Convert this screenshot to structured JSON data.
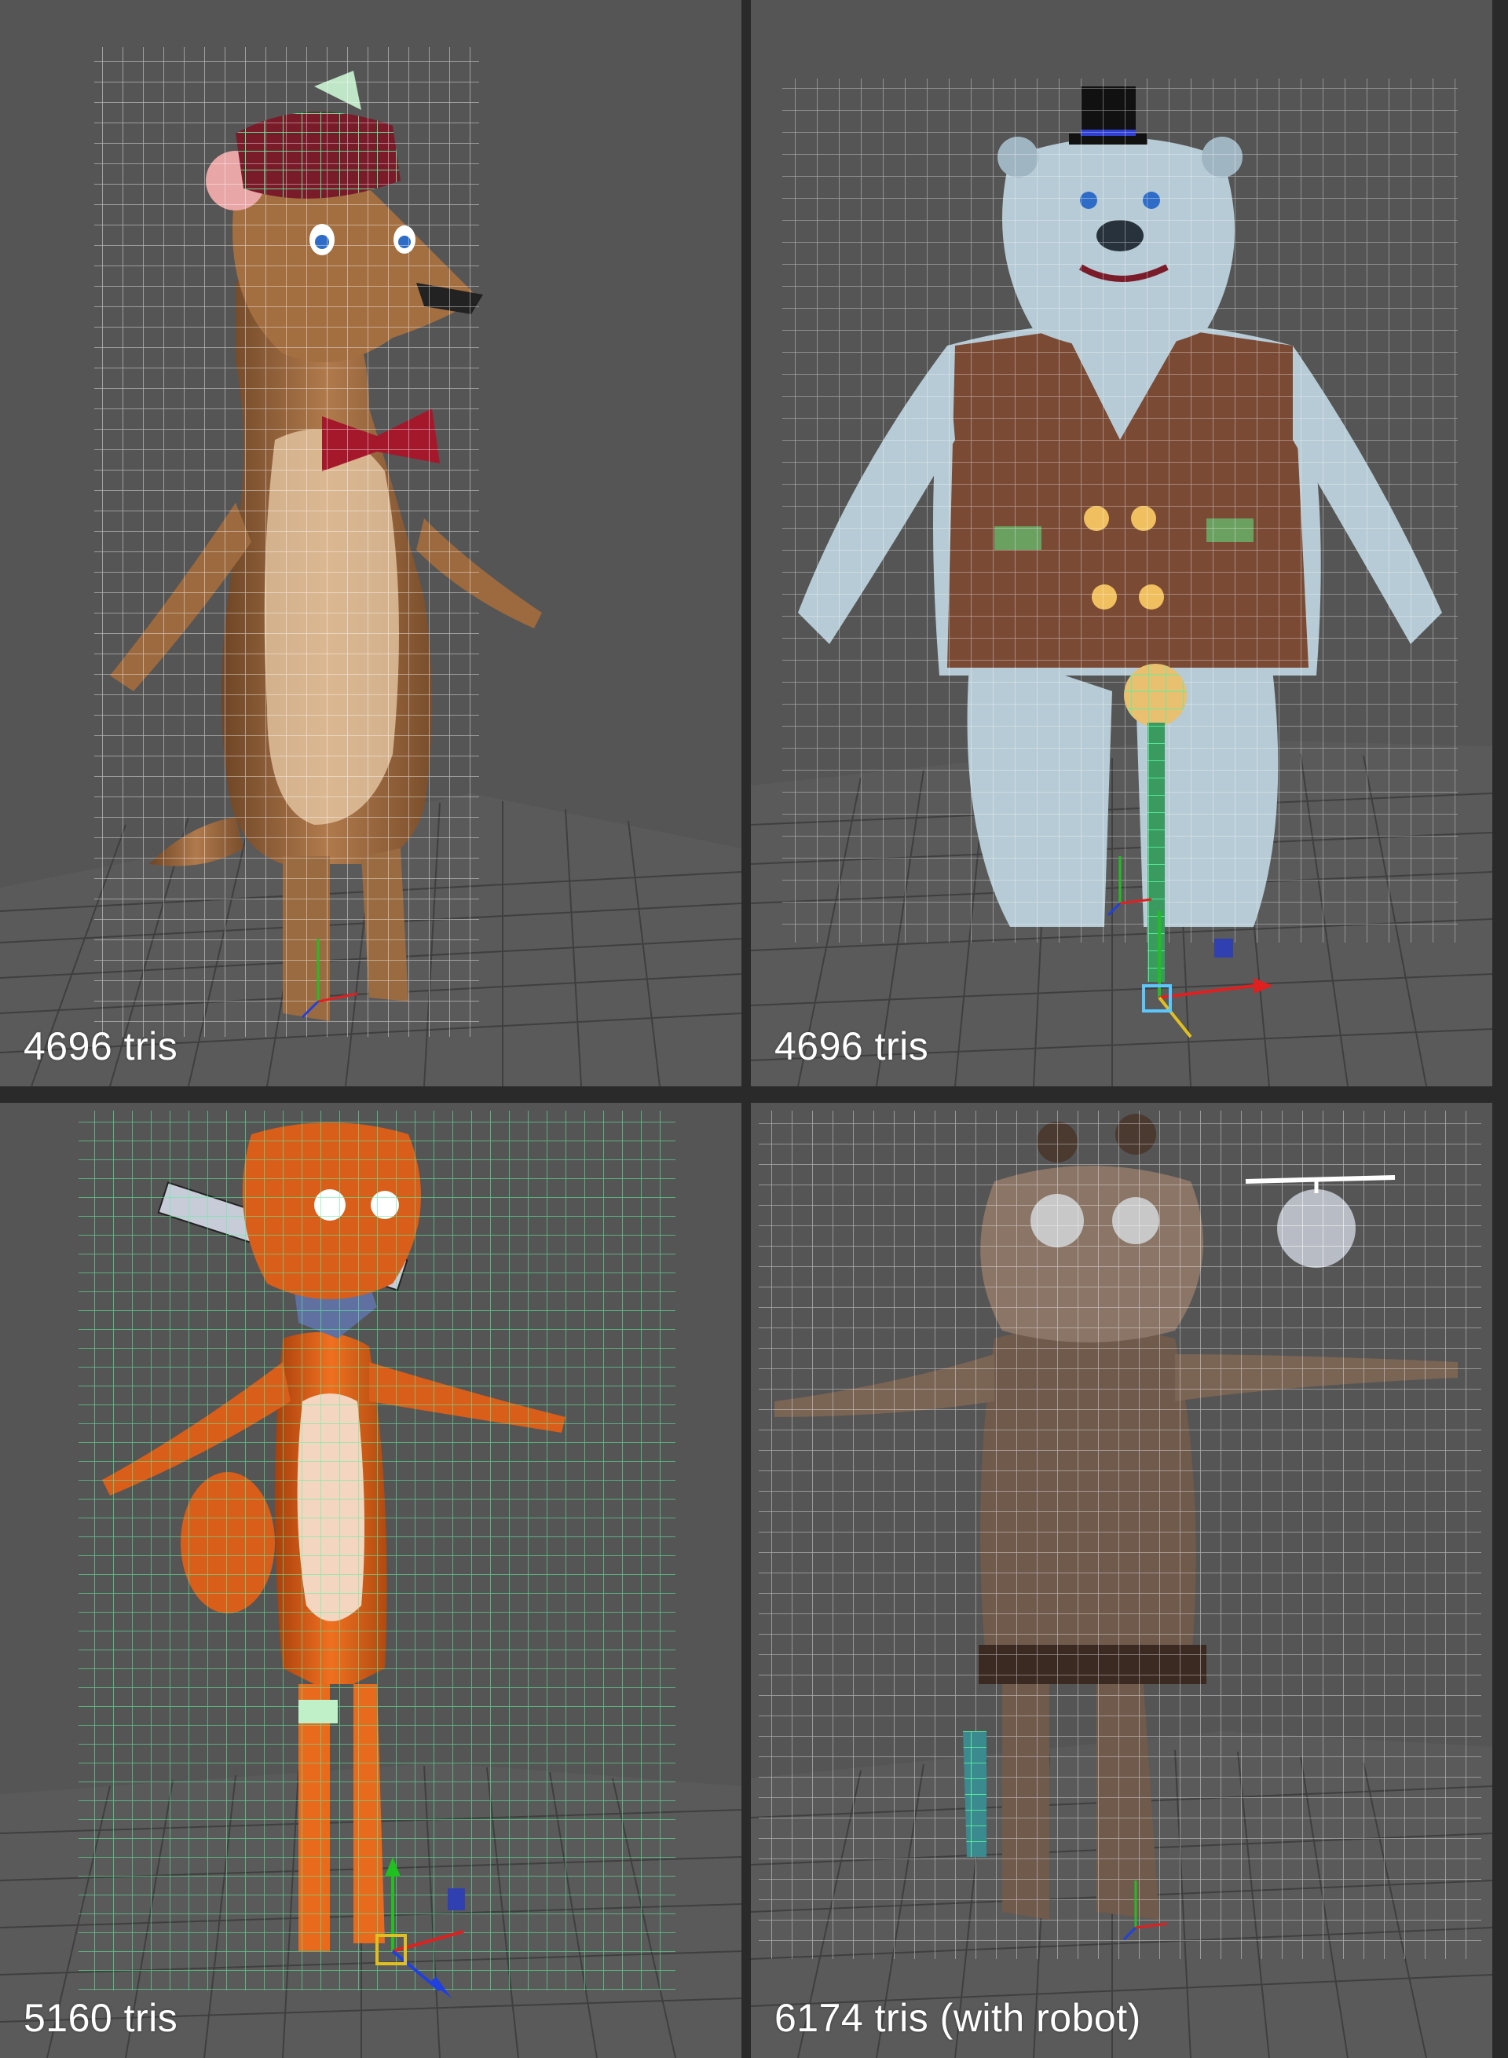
{
  "viewports": [
    {
      "id": "weasel",
      "tris_label": "4696 tris"
    },
    {
      "id": "bear",
      "tris_label": "4696 tris"
    },
    {
      "id": "fox",
      "tris_label": "5160 tris"
    },
    {
      "id": "raccoon",
      "tris_label": "6174 tris (with robot)"
    }
  ],
  "colors": {
    "viewport_bg": "#555555",
    "divider": "#2a2a2a",
    "wire_white": "#ffffff",
    "wire_selected": "#5ff0a0",
    "axis_x": "#e02020",
    "axis_y": "#20c020",
    "axis_z": "#2040e0"
  },
  "icons": [
    "ground-grid",
    "axis-gizmo",
    "move-manipulator"
  ]
}
